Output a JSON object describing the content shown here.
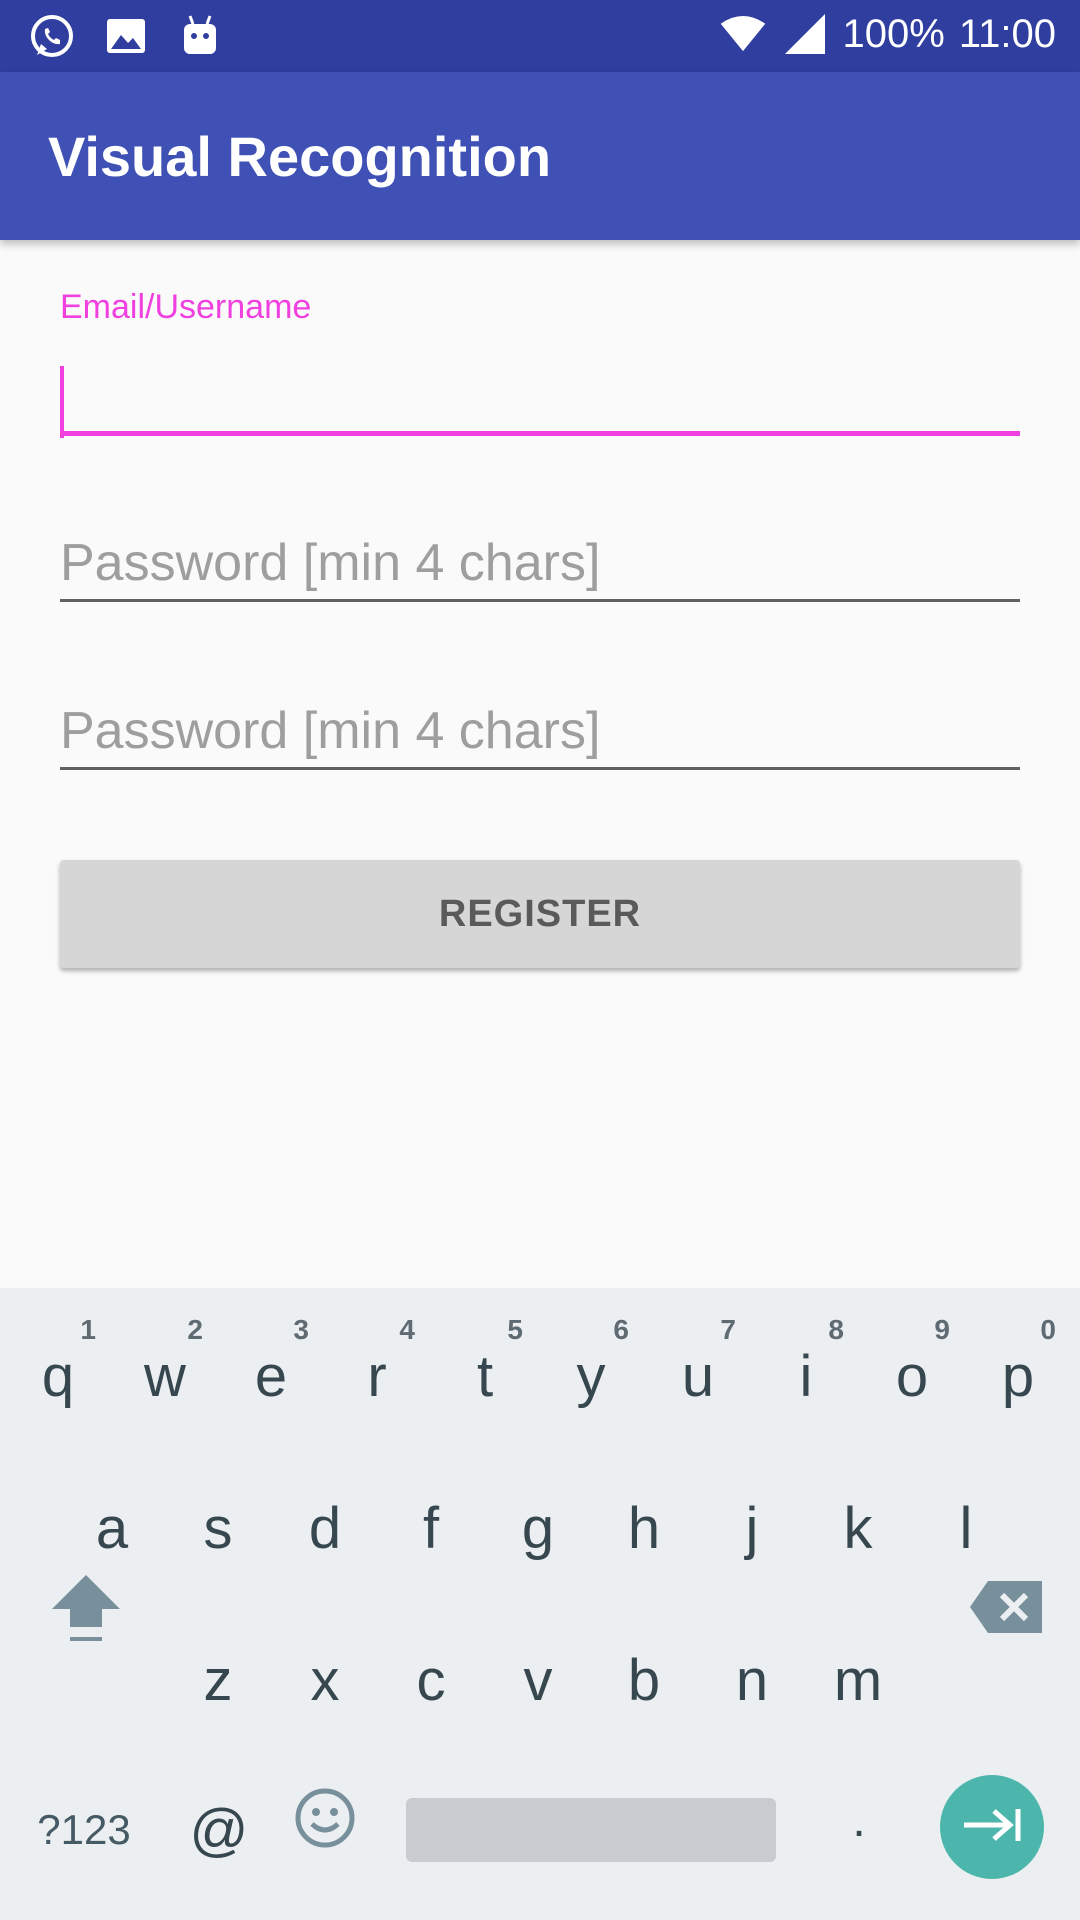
{
  "status_bar": {
    "battery": "100%",
    "time": "11:00",
    "icons": [
      "whatsapp-icon",
      "image-icon",
      "android-icon",
      "wifi-icon",
      "signal-icon"
    ]
  },
  "app_bar": {
    "title": "Visual Recognition",
    "color": "#3f51b5"
  },
  "form": {
    "email_label": "Email/Username",
    "email_value": "",
    "password_placeholder": "Password [min 4 chars]",
    "confirm_password_placeholder": "Password [min 4 chars]",
    "register_label": "REGISTER",
    "accent_color": "#f040e0"
  },
  "keyboard": {
    "row1": [
      {
        "k": "q",
        "h": "1"
      },
      {
        "k": "w",
        "h": "2"
      },
      {
        "k": "e",
        "h": "3"
      },
      {
        "k": "r",
        "h": "4"
      },
      {
        "k": "t",
        "h": "5"
      },
      {
        "k": "y",
        "h": "6"
      },
      {
        "k": "u",
        "h": "7"
      },
      {
        "k": "i",
        "h": "8"
      },
      {
        "k": "o",
        "h": "9"
      },
      {
        "k": "p",
        "h": "0"
      }
    ],
    "row2": [
      "a",
      "s",
      "d",
      "f",
      "g",
      "h",
      "j",
      "k",
      "l"
    ],
    "row3": [
      "z",
      "x",
      "c",
      "v",
      "b",
      "n",
      "m"
    ],
    "symbols_label": "?123",
    "at_label": "@",
    "period_label": "."
  }
}
